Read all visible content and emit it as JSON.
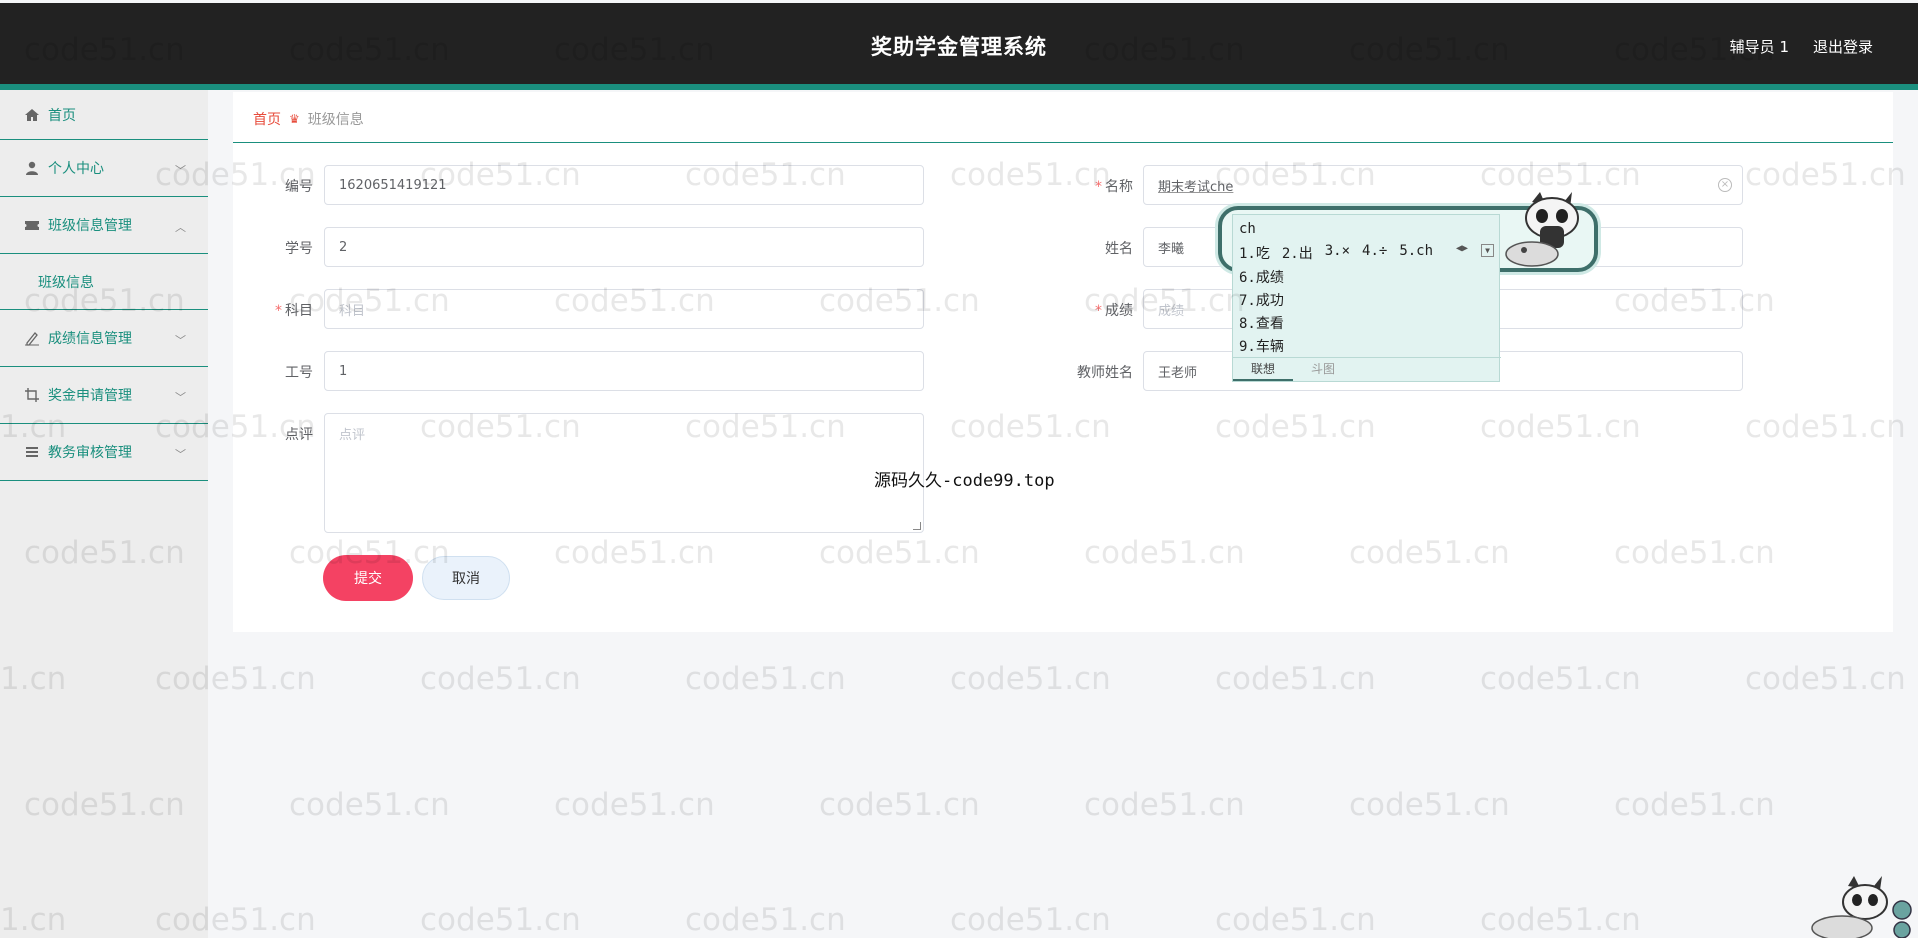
{
  "header": {
    "title": "奖助学金管理系统",
    "user": "辅导员 1",
    "logout": "退出登录"
  },
  "sidebar": {
    "items": [
      {
        "label": "首页",
        "icon": "home-icon"
      },
      {
        "label": "个人中心",
        "icon": "user-icon"
      },
      {
        "label": "班级信息管理",
        "icon": "ticket-icon",
        "expanded": true
      },
      {
        "label": "成绩信息管理",
        "icon": "pen-icon"
      },
      {
        "label": "奖金申请管理",
        "icon": "crop-icon"
      },
      {
        "label": "教务审核管理",
        "icon": "list-icon"
      }
    ],
    "submenu": {
      "label": "班级信息"
    }
  },
  "breadcrumb": {
    "home": "首页",
    "current": "班级信息"
  },
  "form": {
    "bianhao": {
      "label": "编号",
      "value": "1620651419121"
    },
    "mingcheng": {
      "label": "名称",
      "value": "期末考试che"
    },
    "xuehao": {
      "label": "学号",
      "value": "2"
    },
    "xingming": {
      "label": "姓名",
      "value": "李曦"
    },
    "kemu": {
      "label": "科目",
      "placeholder": "科目"
    },
    "chengji": {
      "label": "成绩",
      "placeholder": "成绩"
    },
    "gonghao": {
      "label": "工号",
      "value": "1"
    },
    "jiaoshi": {
      "label": "教师姓名",
      "value": "王老师"
    },
    "dianping": {
      "label": "点评",
      "placeholder": "点评"
    },
    "submit": "提交",
    "cancel": "取消"
  },
  "ime": {
    "input": "ch",
    "row1": [
      "1.吃",
      "2.出",
      "3.×",
      "4.÷",
      "5.ch"
    ],
    "candidates": [
      "6.成绩",
      "7.成功",
      "8.查看",
      "9.车辆"
    ],
    "tab_active": "联想",
    "tab_inactive": "斗图"
  },
  "watermark": {
    "text": "code51.cn",
    "text_partial": "1.cn",
    "center": "源码久久-code99.top"
  },
  "colors": {
    "header_bg": "#222222",
    "accent": "#1a8f7e",
    "submit": "#f44263",
    "breadcrumb_home": "#e74c3c"
  }
}
